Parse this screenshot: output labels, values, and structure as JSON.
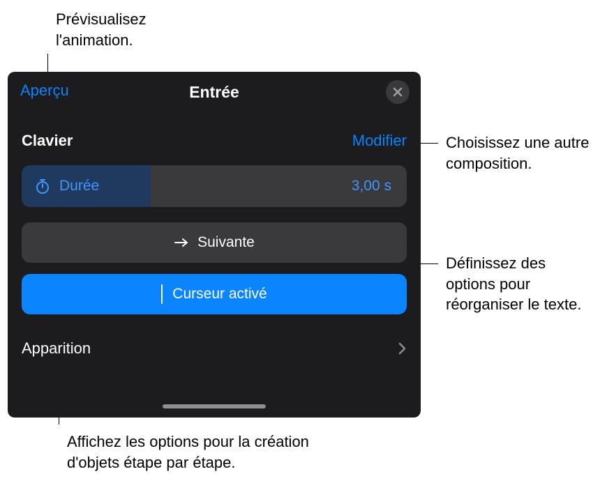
{
  "header": {
    "preview_label": "Aperçu",
    "title": "Entrée"
  },
  "section": {
    "title": "Clavier",
    "modify_label": "Modifier"
  },
  "duration": {
    "label": "Durée",
    "value": "3,00 s"
  },
  "next_button": {
    "label": "Suivante"
  },
  "cursor_button": {
    "label": "Curseur activé"
  },
  "appearance": {
    "label": "Apparition"
  },
  "callouts": {
    "preview": "Prévisualisez l'animation.",
    "modify": "Choisissez une autre composition.",
    "next": "Définissez des options pour réorganiser le texte.",
    "appearance": "Affichez les options pour la création d'objets étape par étape."
  }
}
